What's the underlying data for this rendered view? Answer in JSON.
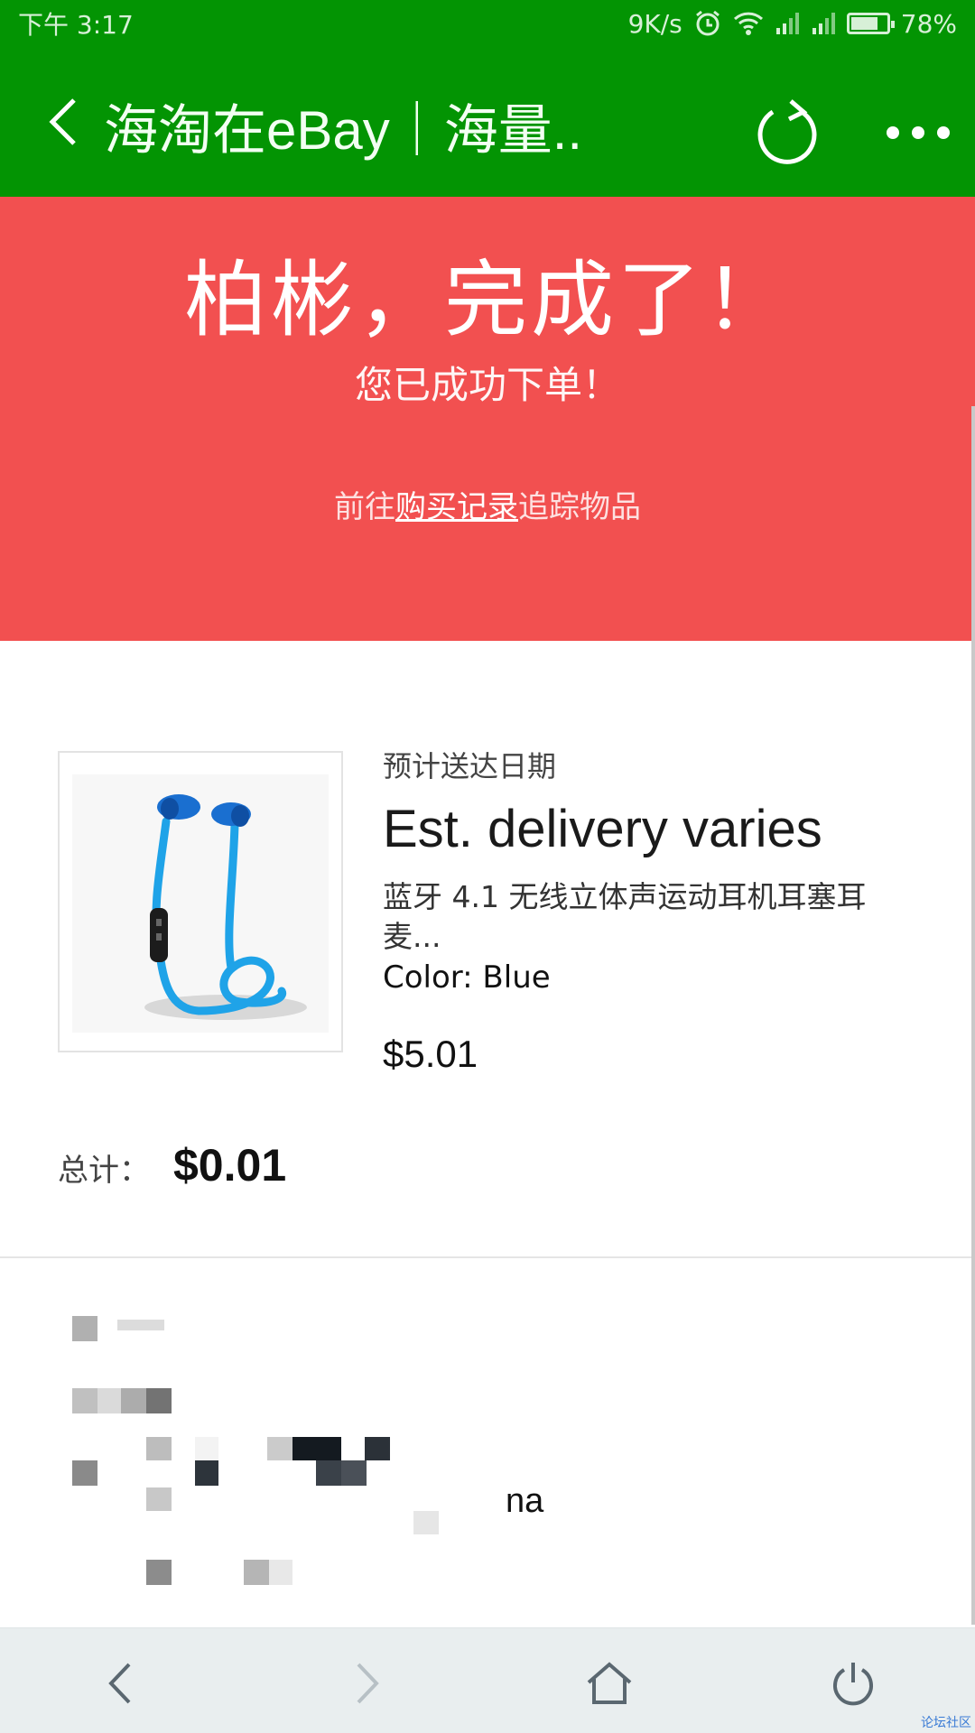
{
  "status_bar": {
    "time": "下午 3:17",
    "network_speed": "9K/s",
    "battery": "78%",
    "battery_level": 0.78,
    "icons": [
      "alarm-icon",
      "wifi-icon",
      "signal-icon",
      "signal-icon",
      "battery-icon"
    ]
  },
  "title_bar": {
    "title": "海淘在eBay｜海量..",
    "icons": [
      "back-arrow-icon",
      "refresh-icon",
      "more-dots-icon"
    ]
  },
  "banner": {
    "title": "柏彬，完成了！",
    "subtitle": "您已成功下单！",
    "link_prefix": "前往",
    "link_text": "购买记录",
    "link_suffix": "追踪物品"
  },
  "item": {
    "est_label": "预计送达日期",
    "est_value": "Est. delivery varies",
    "title": "蓝牙 4.1 无线立体声运动耳机耳塞耳麦...",
    "color": "Color: Blue",
    "price": "$5.01",
    "image": "blue-bluetooth-earphones-image"
  },
  "total": {
    "label": "总计：",
    "value": "$0.01"
  },
  "address": {
    "visible_text": "na"
  },
  "bottom_nav": {
    "icons": [
      "nav-back-icon",
      "nav-forward-icon",
      "home-icon",
      "power-icon"
    ],
    "watermark": "论坛社区"
  },
  "colors": {
    "header_green": "#039403",
    "banner_red": "#f25050",
    "nav_bg": "#e9eeef"
  }
}
